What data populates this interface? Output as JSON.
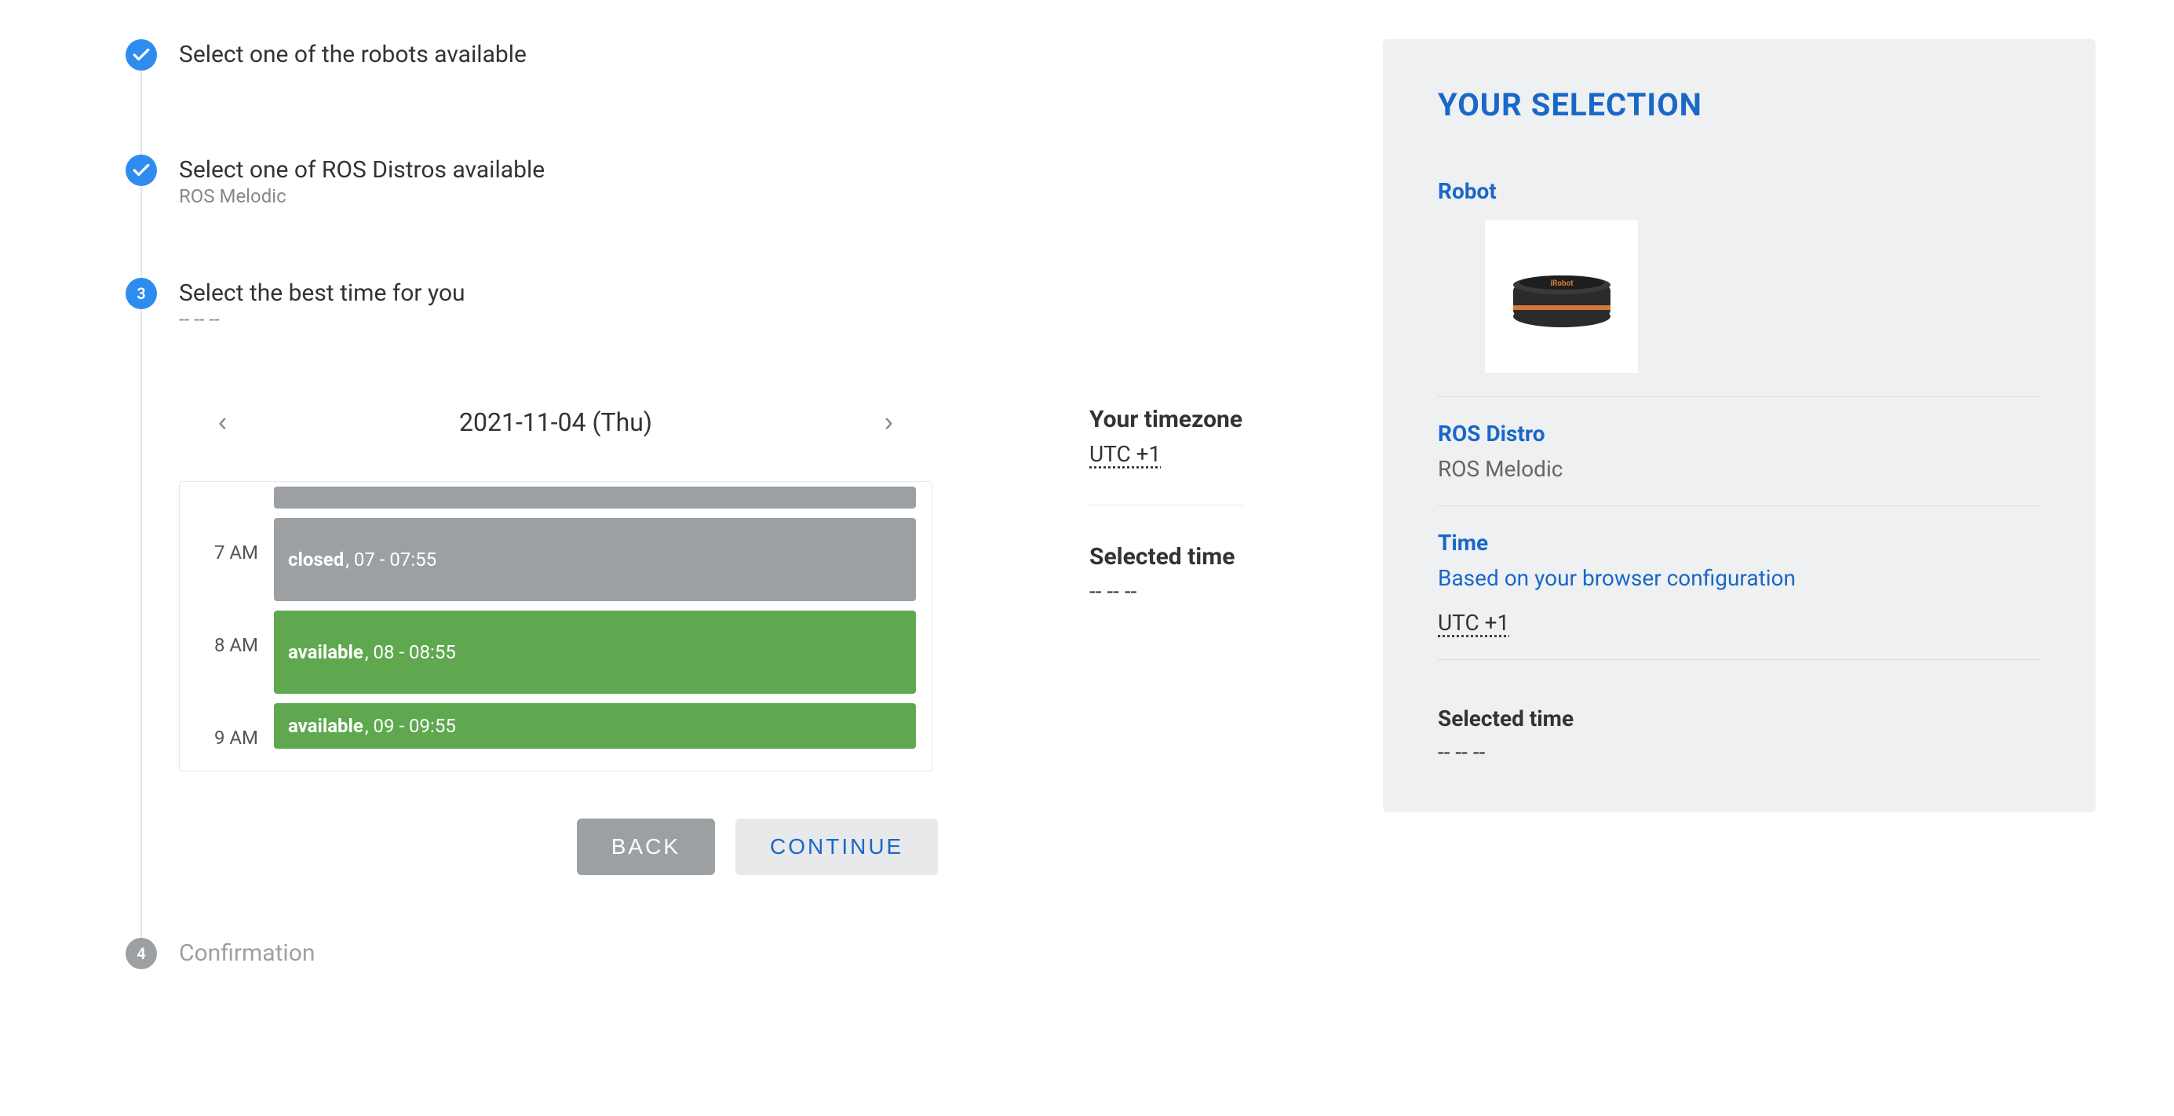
{
  "steps": {
    "s1": {
      "title": "Select one of the robots available"
    },
    "s2": {
      "title": "Select one of ROS Distros available",
      "sub": "ROS Melodic"
    },
    "s3": {
      "title": "Select the best time for you",
      "sub": "-- -- --",
      "badge": "3"
    },
    "s4": {
      "title": "Confirmation",
      "badge": "4"
    }
  },
  "date": {
    "label": "2021-11-04 (Thu)"
  },
  "slots": {
    "r0": {
      "hour": "7 AM",
      "status_label": "closed",
      "time": ", 07 - 07:55"
    },
    "r1": {
      "hour": "8 AM",
      "status_label": "available",
      "time": ", 08 - 08:55"
    },
    "r2": {
      "hour": "9 AM",
      "status_label": "available",
      "time": ", 09 - 09:55"
    }
  },
  "timezone": {
    "heading": "Your timezone",
    "value": "UTC +1",
    "selected_heading": "Selected time",
    "selected_value": "-- -- --"
  },
  "buttons": {
    "back": "BACK",
    "continue": "CONTINUE"
  },
  "sidebar": {
    "title": "YOUR SELECTION",
    "robot_label": "Robot",
    "distro_label": "ROS Distro",
    "distro_value": "ROS Melodic",
    "time_label": "Time",
    "time_hint": "Based on your browser configuration",
    "time_utc": "UTC +1",
    "seltime_label": "Selected time",
    "seltime_value": "-- -- --"
  }
}
